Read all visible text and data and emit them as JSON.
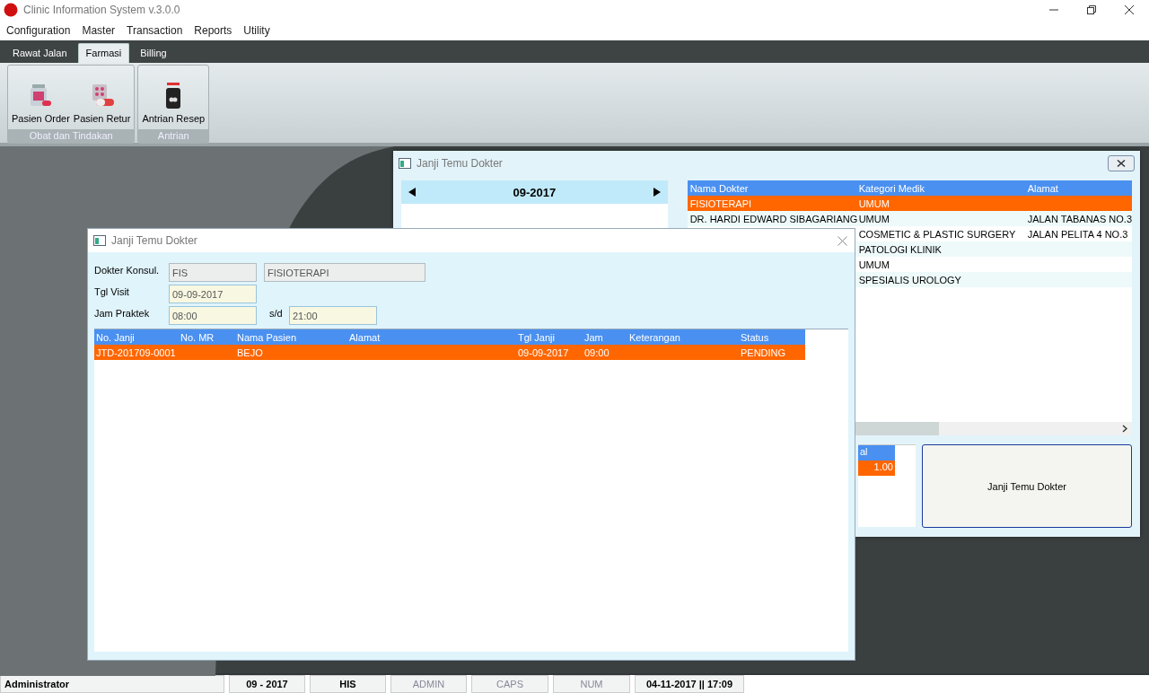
{
  "app": {
    "title": "Clinic Information System v.3.0.0"
  },
  "menu": [
    "Configuration",
    "Master",
    "Transaction",
    "Reports",
    "Utility"
  ],
  "ribbon_tabs": [
    {
      "label": "Rawat Jalan",
      "selected": false
    },
    {
      "label": "Farmasi",
      "selected": true
    },
    {
      "label": "Billing",
      "selected": false
    }
  ],
  "ribbon_groups": [
    {
      "label": "Obat dan Tindakan",
      "buttons": [
        {
          "label": "Pasien Order",
          "kind": "order"
        },
        {
          "label": "Pasien Retur",
          "kind": "retur"
        }
      ]
    },
    {
      "label": "Antrian",
      "buttons": [
        {
          "label": "Antrian Resep",
          "kind": "queue"
        }
      ]
    }
  ],
  "back_window": {
    "title": "Janji Temu Dokter",
    "month": "09-2017",
    "doctor_table": {
      "columns": [
        "Nama Dokter",
        "Kategori Medik",
        "Alamat"
      ],
      "rows": [
        {
          "nama": "FISIOTERAPI",
          "kategori": "UMUM",
          "selected": true
        },
        {
          "nama": "DR. HARDI EDWARD SIBAGARIANG",
          "kategori": "UMUM",
          "alamat": "JALAN TABANAS NO.3",
          "selected": false
        },
        {
          "kategori": "COSMETIC & PLASTIC SURGERY",
          "alamat": "JALAN PELITA 4 NO.3",
          "selected": false
        },
        {
          "kategori": "PATOLOGI KLINIK",
          "selected": false
        },
        {
          "kategori": "UMUM",
          "selected": false
        },
        {
          "kategori": "SPESIALIS UROLOGY",
          "selected": false
        }
      ]
    },
    "summary_table": {
      "header": "al",
      "value": "1.00"
    },
    "button": "Janji Temu Dokter"
  },
  "front_window": {
    "title": "Janji Temu Dokter",
    "form_rows": [
      {
        "label": "Dokter Konsul.",
        "inputs": [
          {
            "value": "FIS",
            "readonly": true
          },
          {
            "value": "FISIOTERAPI",
            "readonly": true
          }
        ]
      },
      {
        "label": "Tgl Visit",
        "inputs": [
          {
            "value": "09-09-2017",
            "readonly": false
          }
        ]
      },
      {
        "label": "Jam Praktek",
        "separator": "s/d",
        "inputs": [
          {
            "value": "08:00",
            "readonly": false
          },
          {
            "value": "21:00",
            "readonly": false
          }
        ]
      }
    ],
    "appointments": {
      "columns": [
        "No. Janji",
        "No. MR",
        "Nama Pasien",
        "Alamat",
        "Tgl Janji",
        "Jam",
        "Keterangan",
        "Status"
      ],
      "rows": [
        {
          "cells": [
            "JTD-201709-0001",
            "",
            "BEJO",
            "",
            "09-09-2017",
            "09:00",
            "",
            "PENDING"
          ],
          "selected": true
        }
      ]
    }
  },
  "status_bar": [
    {
      "text": "Administrator",
      "enabled": true
    },
    {
      "text": "09 - 2017",
      "enabled": true
    },
    {
      "text": "HIS",
      "enabled": true
    },
    {
      "text": "ADMIN",
      "enabled": false
    },
    {
      "text": "CAPS",
      "enabled": false
    },
    {
      "text": "NUM",
      "enabled": false
    },
    {
      "text": "04-11-2017 || 17:09",
      "enabled": true
    }
  ]
}
